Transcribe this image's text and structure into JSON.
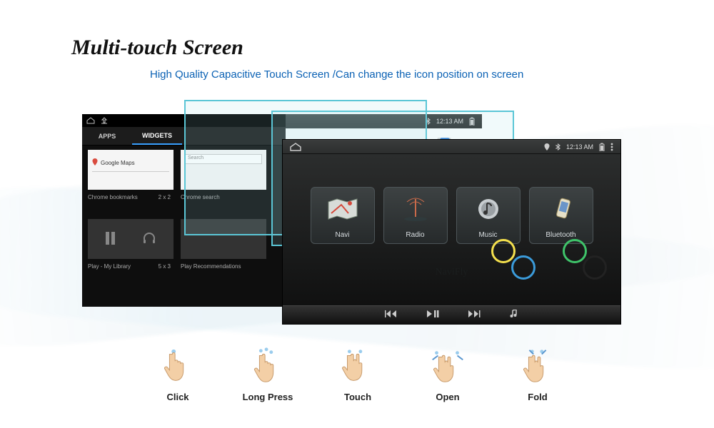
{
  "heading": "Multi-touch Screen",
  "subtitle": "High Quality Capacitive Touch Screen /Can change the icon position on screen",
  "left_panel": {
    "tabs": {
      "apps": "APPS",
      "widgets": "WIDGETS"
    },
    "col1": {
      "card_line1": "Google Maps",
      "caption": "Chrome bookmarks",
      "size": "2 x 2",
      "caption2": "Play - My Library",
      "size2": "5 x 3"
    },
    "col2": {
      "card_line1": "Search",
      "caption": "Chrome search",
      "caption2": "Play Recommendations"
    }
  },
  "mid_bar": {
    "time": "12:13 AM"
  },
  "front": {
    "status": {
      "time": "12:13 AM"
    },
    "tiles": [
      {
        "label": "Navi"
      },
      {
        "label": "Radio"
      },
      {
        "label": "Music"
      },
      {
        "label": "Bluetooth"
      }
    ],
    "brand": "NaviFly"
  },
  "gestures": [
    {
      "label": "Click"
    },
    {
      "label": "Long Press"
    },
    {
      "label": "Touch"
    },
    {
      "label": "Open"
    },
    {
      "label": "Fold"
    }
  ]
}
